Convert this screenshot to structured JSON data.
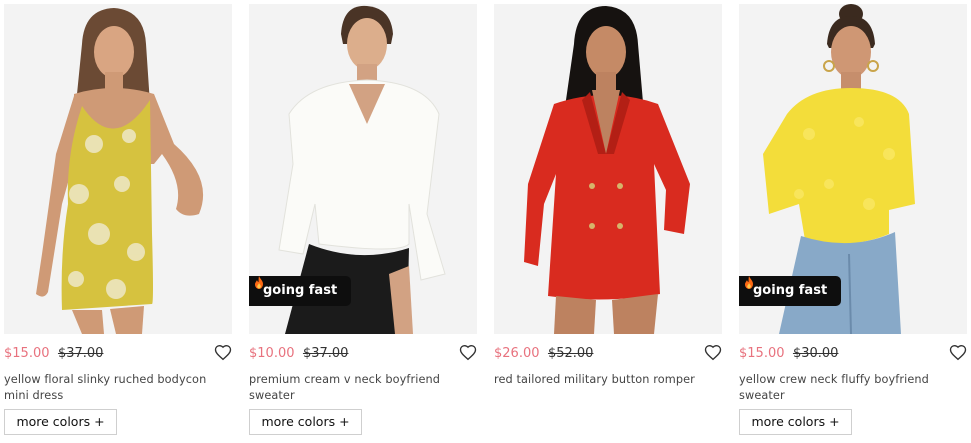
{
  "products": [
    {
      "price_now": "$15.00",
      "price_was": "$37.00",
      "name": "yellow floral slinky ruched bodycon mini dress",
      "more_colors": "more colors +",
      "badge": ""
    },
    {
      "price_now": "$10.00",
      "price_was": "$37.00",
      "name": "premium cream v neck boyfriend sweater",
      "more_colors": "more colors +",
      "badge": "going fast"
    },
    {
      "price_now": "$26.00",
      "price_was": "$52.00",
      "name": "red tailored military button romper",
      "more_colors": "",
      "badge": ""
    },
    {
      "price_now": "$15.00",
      "price_was": "$30.00",
      "name": "yellow crew neck fluffy boyfriend sweater",
      "more_colors": "more colors +",
      "badge": "going fast"
    }
  ],
  "colors": {
    "sale_price": "#e8727e",
    "badge_bg": "#0e0e0e",
    "image_bg": "#f1f1f1"
  },
  "icons": {
    "wishlist": "heart-outline-icon",
    "badge": "flame-icon"
  }
}
